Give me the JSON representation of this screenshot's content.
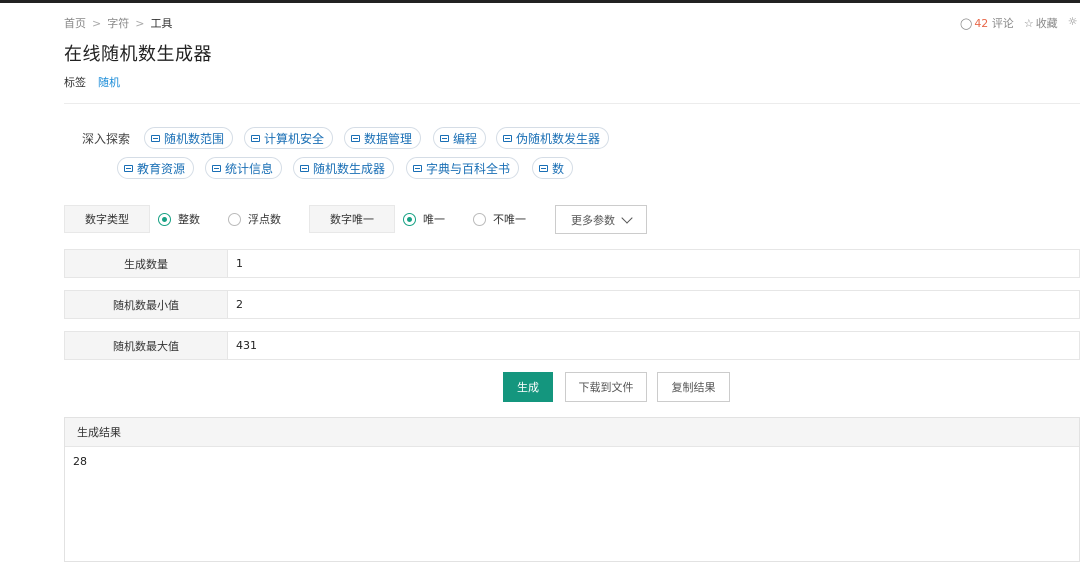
{
  "breadcrumb": {
    "items": [
      "首页",
      "字符",
      "工具"
    ],
    "sep": ">"
  },
  "top_actions": {
    "comment_count": "42",
    "comment_label": "评论",
    "favorite_label": "收藏"
  },
  "page": {
    "title": "在线随机数生成器"
  },
  "tags": {
    "label": "标签",
    "items": [
      "随机"
    ]
  },
  "explore": {
    "label": "深入探索",
    "chips": [
      "随机数范围",
      "计算机安全",
      "数据管理",
      "编程",
      "伪随机数发生器",
      "教育资源",
      "统计信息",
      "随机数生成器",
      "字典与百科全书",
      "数"
    ]
  },
  "options": {
    "number_type_label": "数字类型",
    "integer_label": "整数",
    "float_label": "浮点数",
    "unique_label": "数字唯一",
    "unique_yes": "唯一",
    "unique_no": "不唯一",
    "more_label": "更多参数",
    "number_type_selected": "整数",
    "unique_selected": "唯一"
  },
  "fields": [
    {
      "label": "生成数量",
      "value": "1"
    },
    {
      "label": "随机数最小值",
      "value": "2"
    },
    {
      "label": "随机数最大值",
      "value": "431"
    }
  ],
  "actions": {
    "generate": "生成",
    "download": "下载到文件",
    "copy": "复制结果"
  },
  "result": {
    "title": "生成结果",
    "value": "28"
  },
  "colors": {
    "accent": "#14967e",
    "link": "#1a8cd8",
    "chip_text": "#1a6fb5",
    "comment_count": "#e8684a"
  }
}
